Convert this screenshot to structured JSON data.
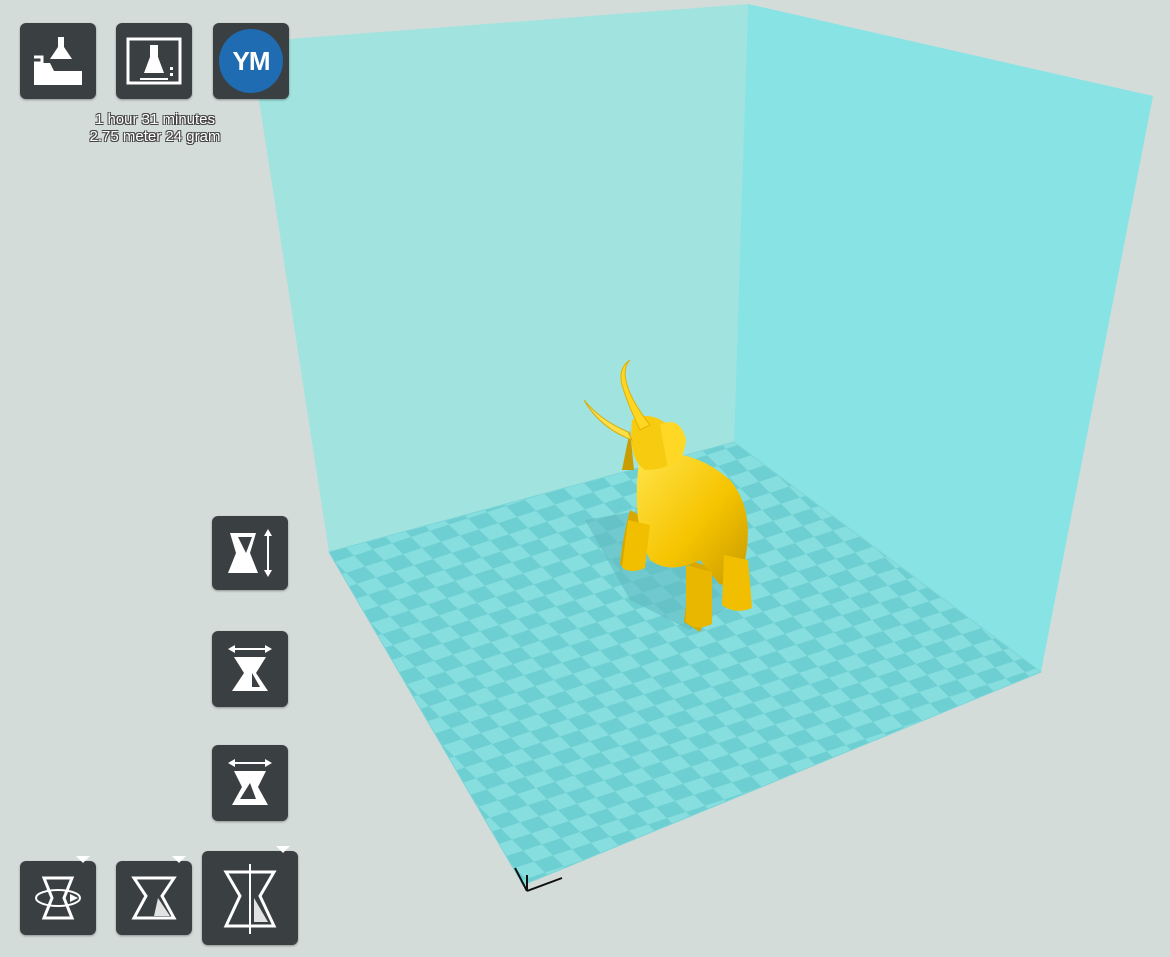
{
  "toolbar": {
    "load_icon": "load-model-icon",
    "prepare_icon": "prepare-print-icon",
    "user_initials": "YM"
  },
  "print_info": {
    "time": "1 hour 31 minutes",
    "material": "2.75 meter 24 gram"
  },
  "side_tools": [
    {
      "name": "scale-tool-button",
      "icon": "scale-icon"
    },
    {
      "name": "mirror-x-tool-button",
      "icon": "mirror-x-icon"
    },
    {
      "name": "mirror-y-tool-button",
      "icon": "mirror-y-icon"
    }
  ],
  "bottom_tools": [
    {
      "name": "rotate-tool-button",
      "icon": "rotate-icon"
    },
    {
      "name": "view-mode-button",
      "icon": "view-mode-icon"
    },
    {
      "name": "settings-mode-button",
      "icon": "settings-mode-icon"
    }
  ],
  "colors": {
    "background": "#d4dcda",
    "build_volume": "#8fe3e3",
    "model": "#f5c800",
    "button": "#3a3f41",
    "avatar": "#1f6cb3"
  }
}
